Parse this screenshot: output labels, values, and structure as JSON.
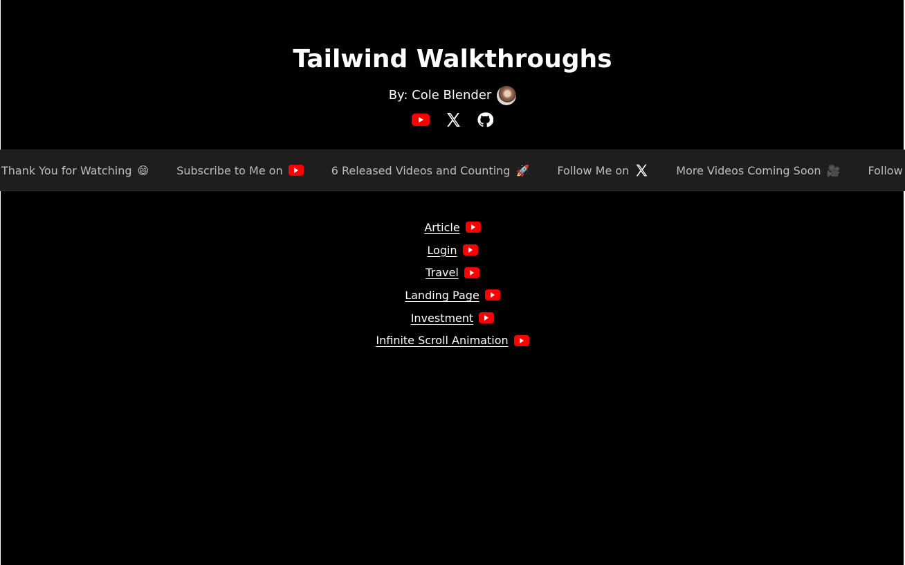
{
  "header": {
    "title": "Tailwind Walkthroughs",
    "byline": "By: Cole Blender"
  },
  "socials": [
    {
      "name": "youtube-icon"
    },
    {
      "name": "x-icon"
    },
    {
      "name": "github-icon"
    }
  ],
  "marquee": {
    "items": [
      {
        "text": "Thank You for Watching",
        "emoji": "😄"
      },
      {
        "text": "Subscribe to Me on",
        "icon": "youtube-icon"
      },
      {
        "text": "6 Released Videos and Counting",
        "emoji": "🚀"
      },
      {
        "text": "Follow Me on",
        "icon": "x-icon"
      },
      {
        "text": "More Videos Coming Soon",
        "emoji": "🎥"
      },
      {
        "text": "Follow Me"
      }
    ]
  },
  "links": [
    {
      "label": "Article"
    },
    {
      "label": "Login"
    },
    {
      "label": "Travel"
    },
    {
      "label": "Landing Page"
    },
    {
      "label": "Investment"
    },
    {
      "label": "Infinite Scroll Animation"
    }
  ],
  "colors": {
    "background": "#000000",
    "marquee_bg": "#1e1e1e",
    "youtube_red": "#ff0000",
    "text": "#ffffff",
    "marquee_text": "#bdbdbd"
  }
}
